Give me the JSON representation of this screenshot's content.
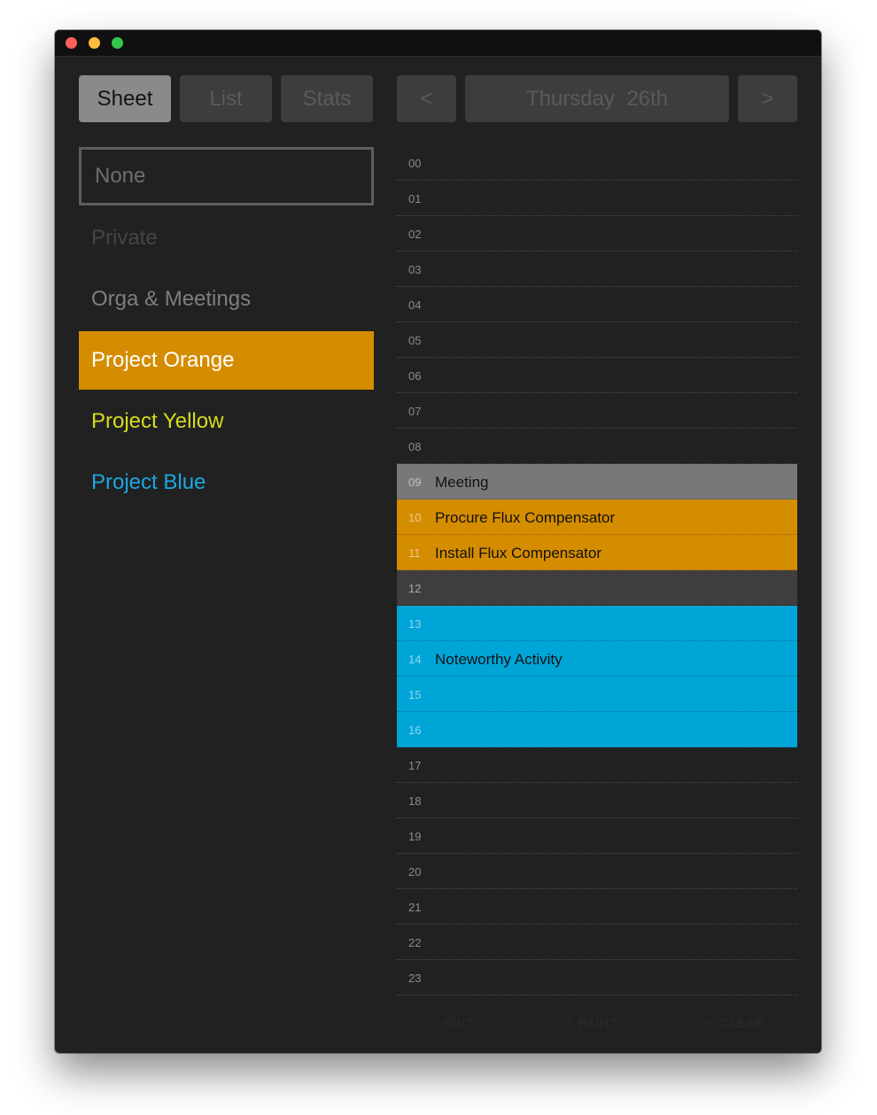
{
  "window": {
    "controls": [
      "close",
      "minimize",
      "zoom"
    ]
  },
  "tabs": [
    {
      "label": "Sheet",
      "active": true
    },
    {
      "label": "List",
      "active": false
    },
    {
      "label": "Stats",
      "active": false
    }
  ],
  "day_nav": {
    "prev_label": "<",
    "title": "Thursday  26th",
    "next_label": ">"
  },
  "categories": [
    {
      "name": "None",
      "color": "#6e6e6e",
      "style": "outlined"
    },
    {
      "name": "Private",
      "color": "#454545",
      "style": "text"
    },
    {
      "name": "Orga & Meetings",
      "color": "#7e7e7e",
      "style": "text"
    },
    {
      "name": "Project Orange",
      "color": "#d48c00",
      "style": "selected"
    },
    {
      "name": "Project Yellow",
      "color": "#d6dd1e",
      "style": "text"
    },
    {
      "name": "Project Blue",
      "color": "#1ba8e0",
      "style": "text"
    }
  ],
  "hours": [
    {
      "hour": "00",
      "label": "",
      "bg": ""
    },
    {
      "hour": "01",
      "label": "",
      "bg": ""
    },
    {
      "hour": "02",
      "label": "",
      "bg": ""
    },
    {
      "hour": "03",
      "label": "",
      "bg": ""
    },
    {
      "hour": "04",
      "label": "",
      "bg": ""
    },
    {
      "hour": "05",
      "label": "",
      "bg": ""
    },
    {
      "hour": "06",
      "label": "",
      "bg": ""
    },
    {
      "hour": "07",
      "label": "",
      "bg": ""
    },
    {
      "hour": "08",
      "label": "",
      "bg": ""
    },
    {
      "hour": "09",
      "label": "Meeting",
      "bg": "#787878"
    },
    {
      "hour": "10",
      "label": "Procure Flux Compensator",
      "bg": "#d48c00"
    },
    {
      "hour": "11",
      "label": "Install Flux Compensator",
      "bg": "#d48c00"
    },
    {
      "hour": "12",
      "label": "",
      "bg": "#3e3e3e"
    },
    {
      "hour": "13",
      "label": "",
      "bg": "#00a5d8"
    },
    {
      "hour": "14",
      "label": "Noteworthy Activity",
      "bg": "#00a5d8"
    },
    {
      "hour": "15",
      "label": "",
      "bg": "#00a5d8"
    },
    {
      "hour": "16",
      "label": "",
      "bg": "#00a5d8"
    },
    {
      "hour": "17",
      "label": "",
      "bg": ""
    },
    {
      "hour": "18",
      "label": "",
      "bg": ""
    },
    {
      "hour": "19",
      "label": "",
      "bg": ""
    },
    {
      "hour": "20",
      "label": "",
      "bg": ""
    },
    {
      "hour": "21",
      "label": "",
      "bg": ""
    },
    {
      "hour": "22",
      "label": "",
      "bg": ""
    },
    {
      "hour": "23",
      "label": "",
      "bg": ""
    }
  ],
  "footer": {
    "edit": "EDIT",
    "paint": "⇧ PAINT",
    "clear": "⌥ CLEAR"
  }
}
